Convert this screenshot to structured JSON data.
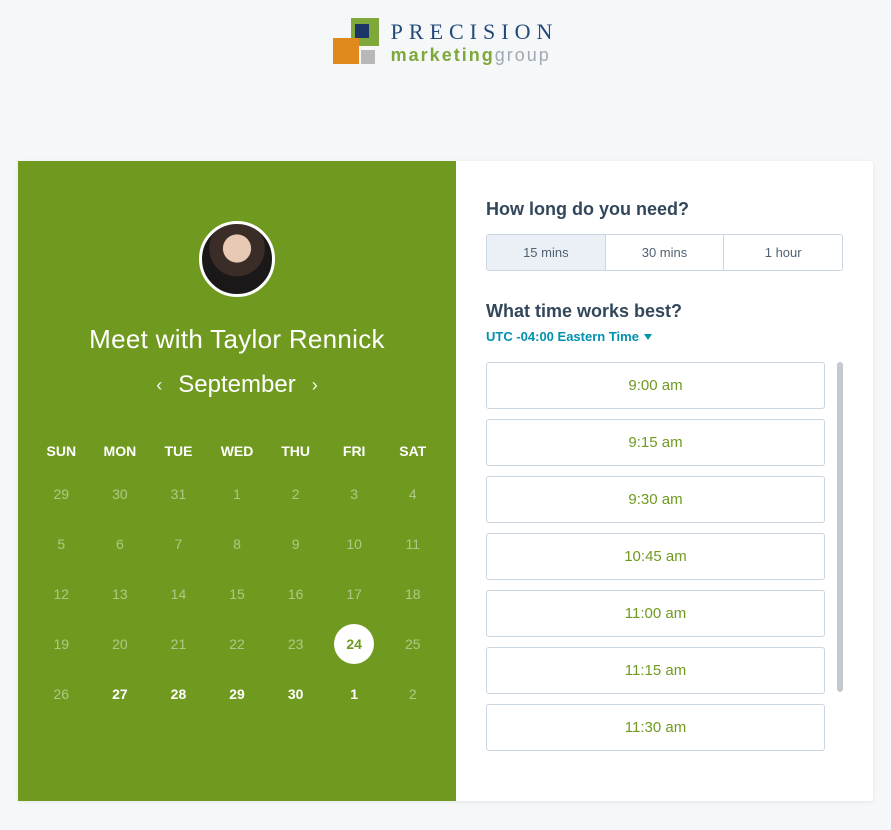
{
  "brand": {
    "line1": "PRECISION",
    "line2a": "marketing",
    "line2b": "group"
  },
  "meeting": {
    "title": "Meet with Taylor Rennick"
  },
  "calendar": {
    "month": "September",
    "dow": [
      "SUN",
      "MON",
      "TUE",
      "WED",
      "THU",
      "FRI",
      "SAT"
    ],
    "rows": [
      [
        {
          "d": "29",
          "dim": true
        },
        {
          "d": "30",
          "dim": true
        },
        {
          "d": "31",
          "dim": true
        },
        {
          "d": "1",
          "dim": true
        },
        {
          "d": "2",
          "dim": true
        },
        {
          "d": "3",
          "dim": true
        },
        {
          "d": "4",
          "dim": true
        }
      ],
      [
        {
          "d": "5",
          "dim": true
        },
        {
          "d": "6",
          "dim": true
        },
        {
          "d": "7",
          "dim": true
        },
        {
          "d": "8",
          "dim": true
        },
        {
          "d": "9",
          "dim": true
        },
        {
          "d": "10",
          "dim": true
        },
        {
          "d": "11",
          "dim": true
        }
      ],
      [
        {
          "d": "12",
          "dim": true
        },
        {
          "d": "13",
          "dim": true
        },
        {
          "d": "14",
          "dim": true
        },
        {
          "d": "15",
          "dim": true
        },
        {
          "d": "16",
          "dim": true
        },
        {
          "d": "17",
          "dim": true
        },
        {
          "d": "18",
          "dim": true
        }
      ],
      [
        {
          "d": "19",
          "dim": true
        },
        {
          "d": "20",
          "dim": true
        },
        {
          "d": "21",
          "dim": true
        },
        {
          "d": "22",
          "dim": true
        },
        {
          "d": "23",
          "dim": true
        },
        {
          "d": "24",
          "selected": true
        },
        {
          "d": "25",
          "dim": true
        }
      ],
      [
        {
          "d": "26",
          "dim": true
        },
        {
          "d": "27",
          "bold": true
        },
        {
          "d": "28",
          "bold": true
        },
        {
          "d": "29",
          "bold": true
        },
        {
          "d": "30",
          "bold": true
        },
        {
          "d": "1",
          "bold": true
        },
        {
          "d": "2",
          "dim": true
        }
      ]
    ]
  },
  "duration": {
    "question": "How long do you need?",
    "options": [
      "15 mins",
      "30 mins",
      "1 hour"
    ],
    "selectedIndex": 0
  },
  "time": {
    "question": "What time works best?",
    "timezone": "UTC -04:00 Eastern Time",
    "slots": [
      "9:00 am",
      "9:15 am",
      "9:30 am",
      "10:45 am",
      "11:00 am",
      "11:15 am",
      "11:30 am"
    ]
  }
}
